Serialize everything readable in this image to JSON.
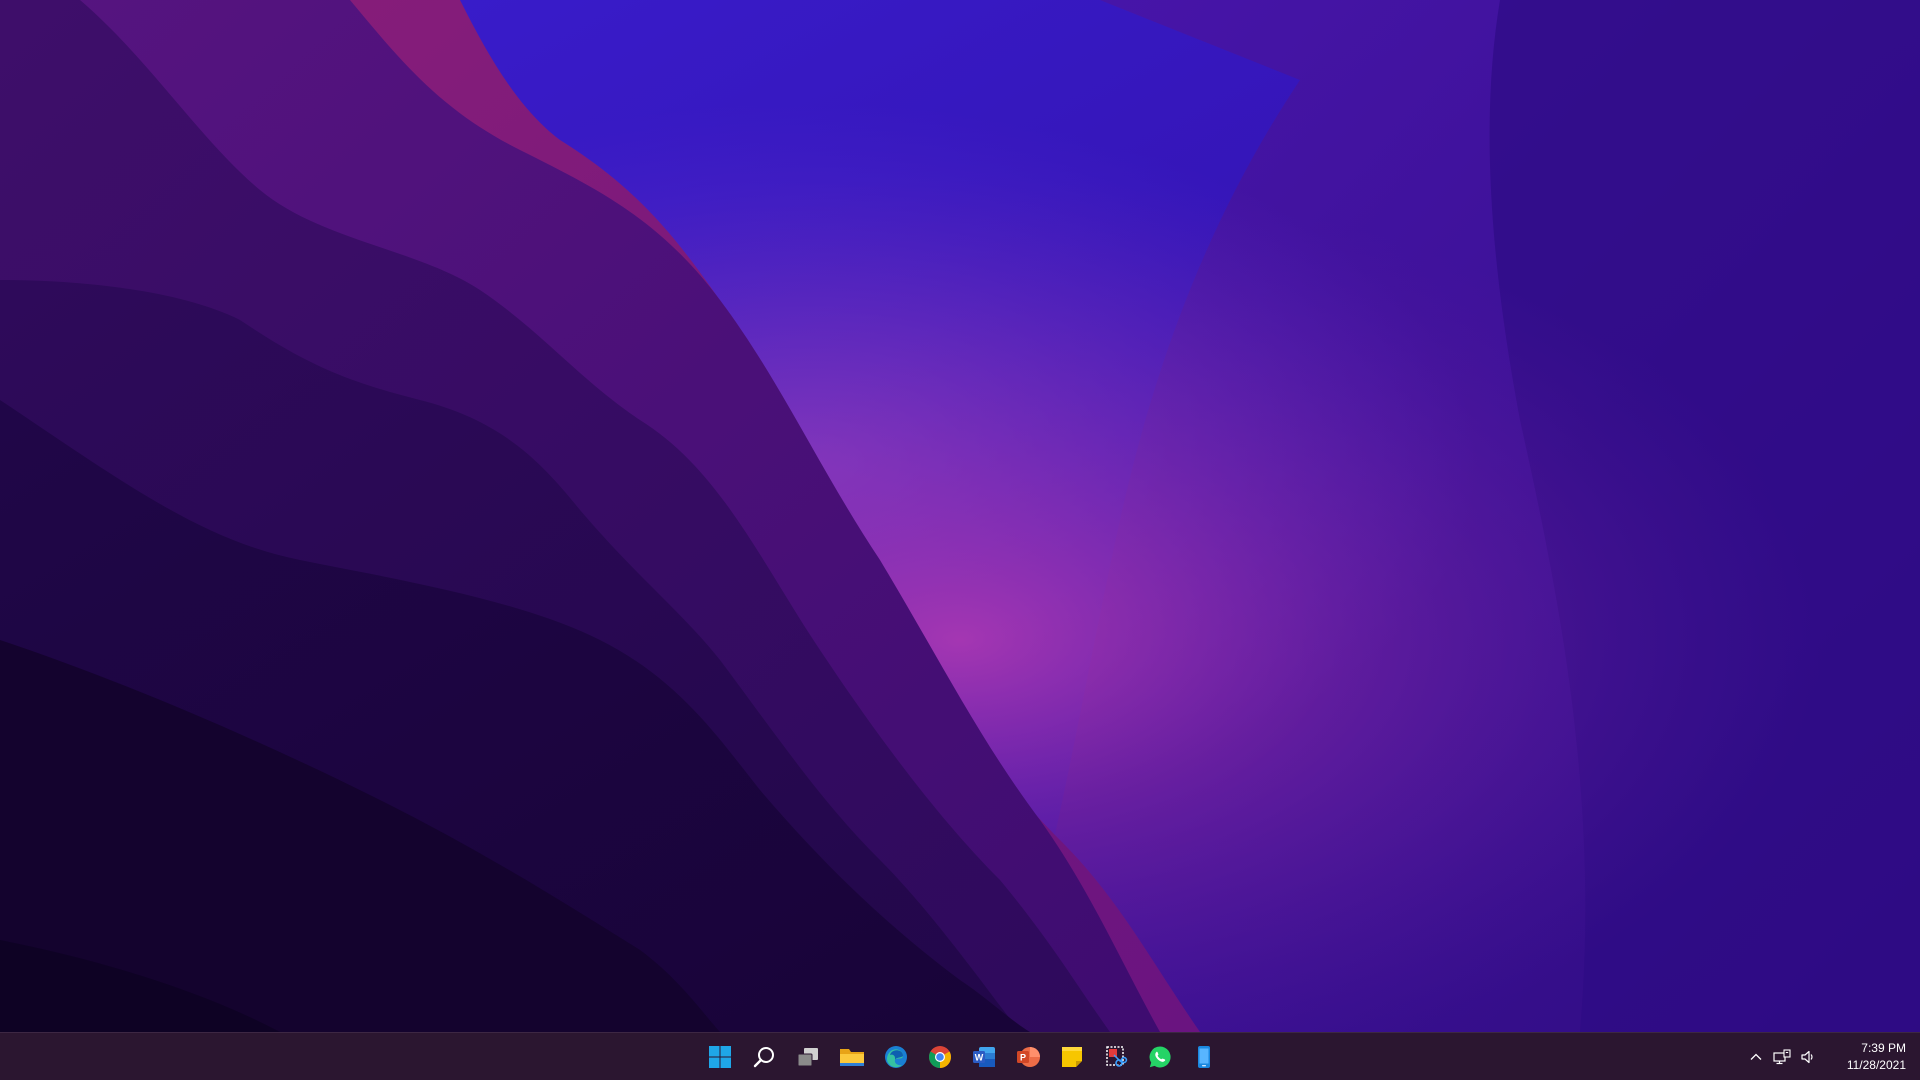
{
  "desktop": {
    "wallpaper": "purple-dunes-abstract"
  },
  "taskbar": {
    "apps": [
      {
        "name": "start",
        "icon": "windows-logo-icon"
      },
      {
        "name": "search",
        "icon": "search-icon"
      },
      {
        "name": "task-view",
        "icon": "task-view-icon"
      },
      {
        "name": "file-explorer",
        "icon": "folder-icon"
      },
      {
        "name": "edge",
        "icon": "edge-browser-icon"
      },
      {
        "name": "chrome",
        "icon": "chrome-browser-icon"
      },
      {
        "name": "word",
        "icon": "word-icon"
      },
      {
        "name": "powerpoint",
        "icon": "powerpoint-icon"
      },
      {
        "name": "sticky-notes",
        "icon": "sticky-notes-icon"
      },
      {
        "name": "snipping-tool",
        "icon": "snipping-tool-icon"
      },
      {
        "name": "whatsapp",
        "icon": "whatsapp-icon"
      },
      {
        "name": "phone-link",
        "icon": "phone-icon"
      }
    ],
    "tray": {
      "icons": [
        "chevron-up-icon",
        "network-icon",
        "volume-icon"
      ],
      "time": "7:39 PM",
      "date": "11/28/2021"
    }
  },
  "colors": {
    "taskbar_bg": "#2b1630",
    "windows_blue": "#1fa7e8",
    "word_blue": "#2b5cc4",
    "powerpoint_orange": "#d24726",
    "whatsapp_green": "#25d366",
    "sticky_yellow": "#f7c600"
  }
}
